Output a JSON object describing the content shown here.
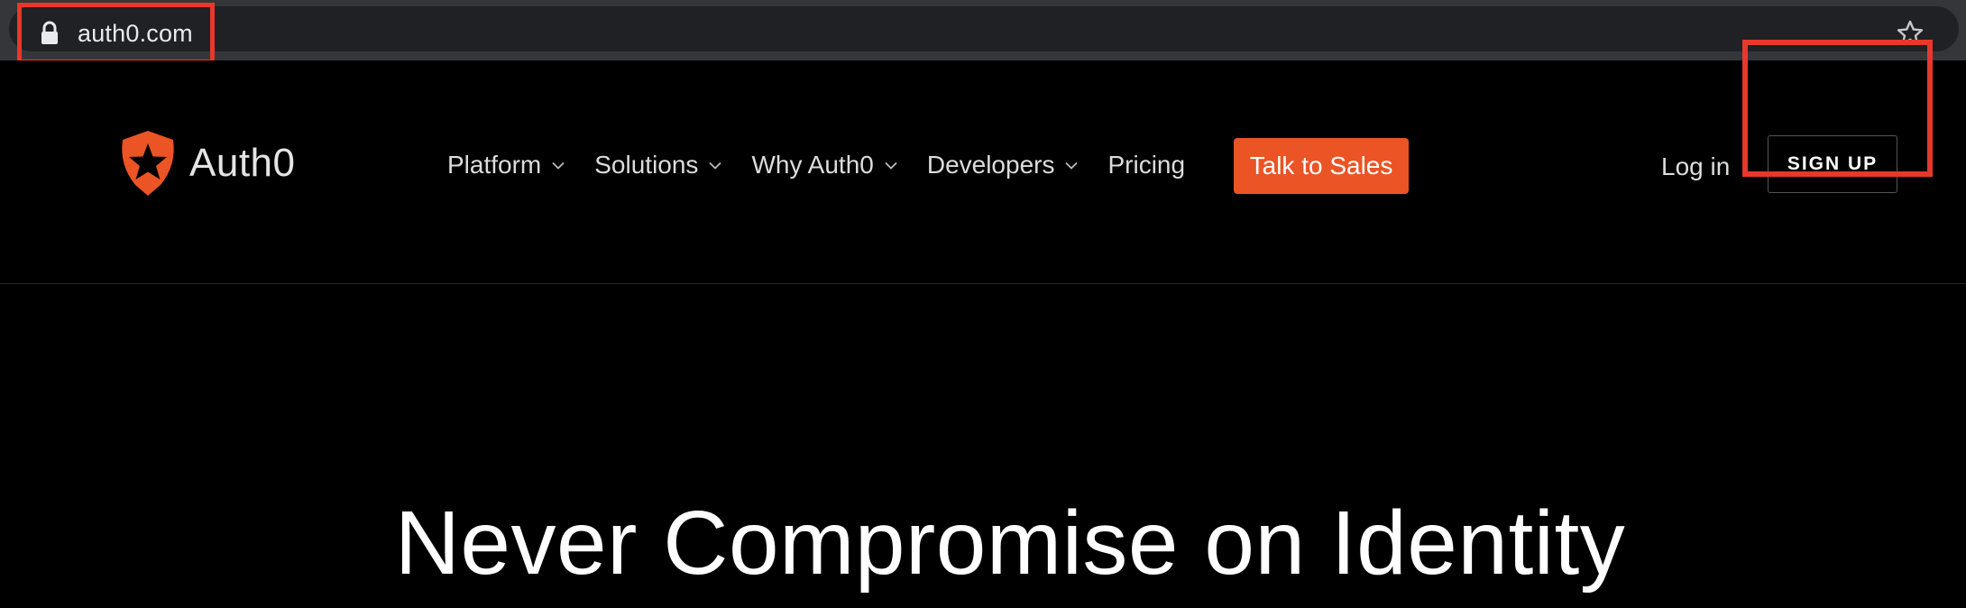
{
  "browser": {
    "url": "auth0.com",
    "lock_icon": "lock-icon",
    "bookmark_icon": "star-outline-icon"
  },
  "header": {
    "logo_text": "Auth0",
    "nav": [
      {
        "label": "Platform",
        "has_dropdown": true
      },
      {
        "label": "Solutions",
        "has_dropdown": true
      },
      {
        "label": "Why Auth0",
        "has_dropdown": true
      },
      {
        "label": "Developers",
        "has_dropdown": true
      },
      {
        "label": "Pricing",
        "has_dropdown": false
      }
    ],
    "cta_label": "Talk to Sales",
    "login_label": "Log in",
    "signup_label": "SIGN UP"
  },
  "hero": {
    "title": "Never Compromise on Identity"
  },
  "colors": {
    "brand_orange": "#eb5424",
    "annotation_red": "#e8382b",
    "background": "#000000"
  }
}
